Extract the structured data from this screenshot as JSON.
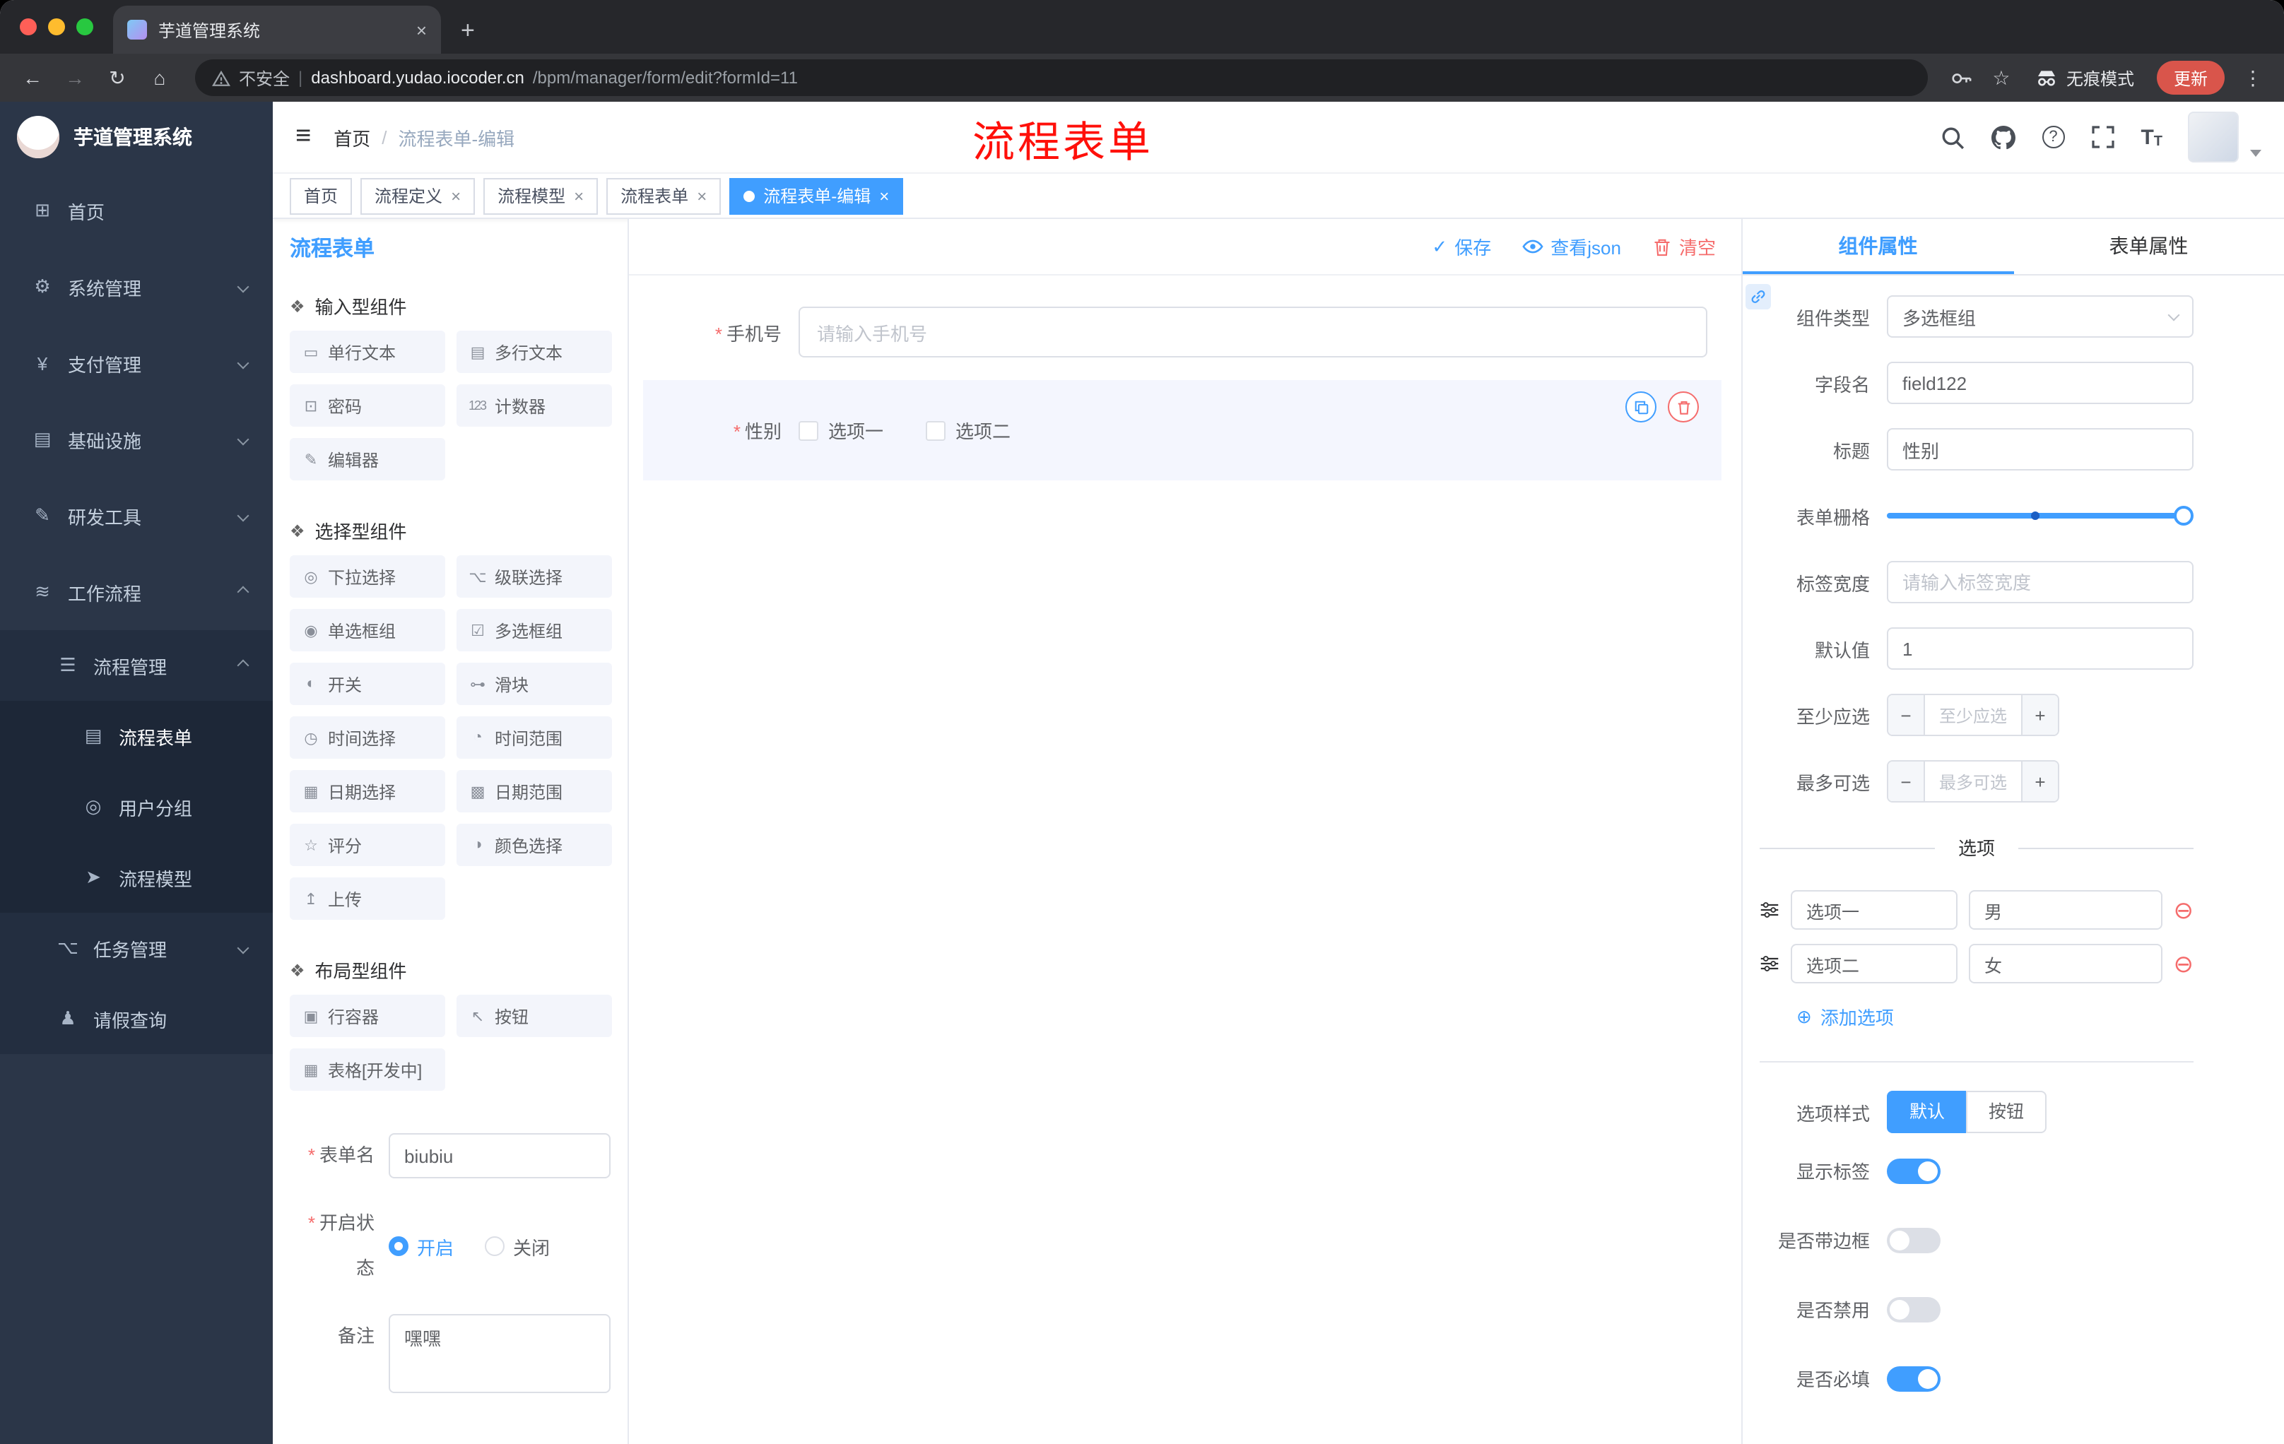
{
  "glyphs": {
    "close": "×",
    "plus": "+",
    "minus": "−",
    "kebab": "⋮",
    "add_circle": "⊕",
    "remove_circle": "⊖",
    "check": "✓",
    "star": "☆",
    "help": "?",
    "back": "←",
    "forward": "→",
    "reload": "↻",
    "home": "⌂",
    "hamburger": "≡",
    "slash": "/",
    "pipe": "|",
    "t": "T"
  },
  "browser": {
    "tab_title": "芋道管理系统",
    "security_label": "不安全",
    "domain": "dashboard.yudao.iocoder.cn",
    "path": "/bpm/manager/form/edit?formId=11",
    "incognito_label": "无痕模式",
    "update_label": "更新"
  },
  "annotation": "流程表单",
  "sidebar": {
    "logo_title": "芋道管理系统",
    "menu": [
      {
        "label": "首页",
        "icon": "⊞"
      },
      {
        "label": "系统管理",
        "icon": "⚙"
      },
      {
        "label": "支付管理",
        "icon": "¥"
      },
      {
        "label": "基础设施",
        "icon": "▤"
      },
      {
        "label": "研发工具",
        "icon": "✎"
      },
      {
        "label": "工作流程",
        "icon": "≋"
      }
    ],
    "process_management": {
      "label": "流程管理",
      "icon": "☰"
    },
    "process_children": [
      {
        "label": "流程表单",
        "icon": "▤"
      },
      {
        "label": "用户分组",
        "icon": "◎"
      },
      {
        "label": "流程模型",
        "icon": "➤"
      }
    ],
    "task_management": {
      "label": "任务管理",
      "icon": "⌥"
    },
    "leave_query": {
      "label": "请假查询",
      "icon": "♟"
    }
  },
  "header": {
    "breadcrumb_home": "首页",
    "breadcrumb_current": "流程表单-编辑"
  },
  "tags": [
    {
      "label": "首页"
    },
    {
      "label": "流程定义"
    },
    {
      "label": "流程模型"
    },
    {
      "label": "流程表单"
    },
    {
      "label": "流程表单-编辑"
    }
  ],
  "palette": {
    "title": "流程表单",
    "sections": [
      {
        "title": "输入型组件",
        "icon": "❖",
        "items": [
          {
            "label": "单行文本",
            "icon": "▭"
          },
          {
            "label": "多行文本",
            "icon": "▤"
          },
          {
            "label": "密码",
            "icon": "⊡"
          },
          {
            "label": "计数器",
            "icon": "123"
          },
          {
            "label": "编辑器",
            "icon": "✎"
          }
        ]
      },
      {
        "title": "选择型组件",
        "icon": "❖",
        "items": [
          {
            "label": "下拉选择",
            "icon": "◎"
          },
          {
            "label": "级联选择",
            "icon": "⌥"
          },
          {
            "label": "单选框组",
            "icon": "◉"
          },
          {
            "label": "多选框组",
            "icon": "☑"
          },
          {
            "label": "开关",
            "icon": "◐"
          },
          {
            "label": "滑块",
            "icon": "⊶"
          },
          {
            "label": "时间选择",
            "icon": "◷"
          },
          {
            "label": "时间范围",
            "icon": "◔"
          },
          {
            "label": "日期选择",
            "icon": "▦"
          },
          {
            "label": "日期范围",
            "icon": "▩"
          },
          {
            "label": "评分",
            "icon": "☆"
          },
          {
            "label": "颜色选择",
            "icon": "◑"
          },
          {
            "label": "上传",
            "icon": "↥"
          }
        ]
      },
      {
        "title": "布局型组件",
        "icon": "❖",
        "items": [
          {
            "label": "行容器",
            "icon": "▣"
          },
          {
            "label": "按钮",
            "icon": "↖"
          },
          {
            "label": "表格[开发中]",
            "icon": "▦"
          }
        ]
      }
    ],
    "form": {
      "name_label": "表单名",
      "name_value": "biubiu",
      "status_label": "开启状态",
      "status_options": [
        "开启",
        "关闭"
      ],
      "remark_label": "备注",
      "remark_value": "嘿嘿"
    }
  },
  "canvas": {
    "toolbar": {
      "save": "保存",
      "view_json": "查看json",
      "clear": "清空"
    },
    "fields": [
      {
        "label": "手机号",
        "placeholder": "请输入手机号"
      },
      {
        "label": "性别",
        "options": [
          "选项一",
          "选项二"
        ]
      }
    ]
  },
  "props": {
    "tabs": [
      "组件属性",
      "表单属性"
    ],
    "component_type": {
      "label": "组件类型",
      "value": "多选框组"
    },
    "field_name": {
      "label": "字段名",
      "value": "field122"
    },
    "title": {
      "label": "标题",
      "value": "性别"
    },
    "grid": {
      "label": "表单栅格"
    },
    "label_width": {
      "label": "标签宽度",
      "placeholder": "请输入标签宽度"
    },
    "default_value": {
      "label": "默认值",
      "value": "1"
    },
    "min_select": {
      "label": "至少应选",
      "placeholder": "至少应选"
    },
    "max_select": {
      "label": "最多可选",
      "placeholder": "最多可选"
    },
    "options_divider": "选项",
    "options": [
      {
        "name": "选项一",
        "value": "男"
      },
      {
        "name": "选项二",
        "value": "女"
      }
    ],
    "add_option": "添加选项",
    "option_style": {
      "label": "选项样式",
      "options": [
        "默认",
        "按钮"
      ]
    },
    "switches": [
      {
        "label": "显示标签"
      },
      {
        "label": "是否带边框"
      },
      {
        "label": "是否禁用"
      },
      {
        "label": "是否必填"
      }
    ]
  }
}
